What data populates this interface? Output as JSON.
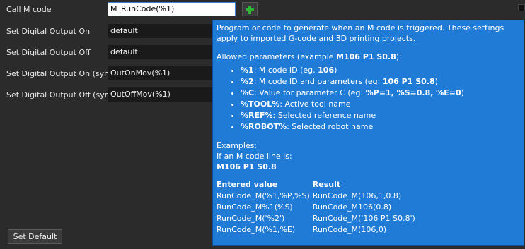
{
  "rows": [
    {
      "label": "Call M code",
      "value": "M_RunCode(%1)"
    },
    {
      "label": "Set Digital Output On",
      "value": "default"
    },
    {
      "label": "Set Digital Output Off",
      "value": "default"
    },
    {
      "label": "Set Digital Output On (sync)",
      "value": "OutOnMov(%1)"
    },
    {
      "label": "Set Digital Output Off (sync)",
      "value": "OutOffMov(%1)"
    }
  ],
  "add_button_icon": "plus-icon",
  "set_default_label": "Set Default",
  "tooltip": {
    "intro": "Program or code to generate when an M code is triggered. These settings apply to imported G-code and 3D printing projects.",
    "allowed_prefix": "Allowed parameters (example ",
    "allowed_example": "M106 P1 S0.8",
    "allowed_suffix": "):",
    "params": [
      {
        "key": "%1",
        "desc_pre": ": M code ID (eg. ",
        "ex": "106",
        "desc_post": ")"
      },
      {
        "key": "%2",
        "desc_pre": ": M code ID and parameters (eg: ",
        "ex": "106 P1 S0.8",
        "desc_post": ")"
      },
      {
        "key": "%C",
        "desc_pre": ": Value for parameter C (eg: ",
        "ex": "%P=1, %S=0.8, %E=0",
        "desc_post": ")"
      },
      {
        "key": "%TOOL%",
        "desc_pre": ": Active tool name",
        "ex": "",
        "desc_post": ""
      },
      {
        "key": "%REF%",
        "desc_pre": ": Selected reference name",
        "ex": "",
        "desc_post": ""
      },
      {
        "key": "%ROBOT%",
        "desc_pre": ": Selected robot name",
        "ex": "",
        "desc_post": ""
      }
    ],
    "examples_title": "Examples:",
    "examples_line": "If an M code line is:",
    "examples_code": "M106 P1 S0.8",
    "table_headers": [
      "Entered value",
      "Result"
    ],
    "table_rows": [
      [
        "RunCode_M(%1,%P,%S)",
        "RunCode_M(106,1,0.8)"
      ],
      [
        "RunCode_M%1(%S)",
        "RunCode_M106(0.8)"
      ],
      [
        "RunCode_M('%2')",
        "RunCode_M('106 P1 S0.8')"
      ],
      [
        "RunCode_M(%1,%E)",
        "RunCode_M(106,0)"
      ]
    ]
  }
}
